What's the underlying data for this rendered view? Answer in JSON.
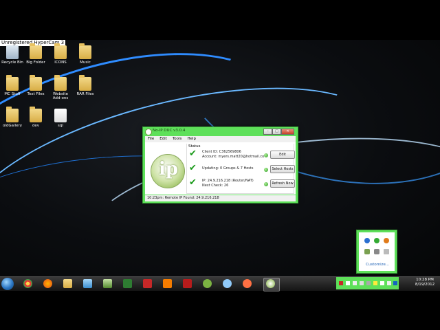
{
  "overlay": {
    "watermark": "Unregistered HyperCam 3"
  },
  "desktop_icons": [
    {
      "label": "Recycle Bin",
      "kind": "recycle"
    },
    {
      "label": "Big Folder",
      "kind": "folder"
    },
    {
      "label": "ICONS",
      "kind": "folder"
    },
    {
      "label": "Music",
      "kind": "folder"
    },
    {
      "label": "MC Stuff",
      "kind": "folder"
    },
    {
      "label": "Text Files",
      "kind": "folder"
    },
    {
      "label": "Website Add-ons",
      "kind": "folder"
    },
    {
      "label": "RAR Files",
      "kind": "folder"
    },
    {
      "label": "oldGallery",
      "kind": "folder"
    },
    {
      "label": "dev",
      "kind": "folder"
    },
    {
      "label": "sql",
      "kind": "doc"
    }
  ],
  "dialog": {
    "title": "No-IP DUC v3.0.4",
    "menu": [
      "File",
      "Edit",
      "Tools",
      "Help"
    ],
    "logo_text": "ip",
    "group_label": "Status",
    "rows": [
      {
        "line1": "Client ID: C362569806",
        "line2": "Account: myers.matt20@hotmail.co",
        "button": "Edit"
      },
      {
        "line1": "Updating: 0 Groups & 7 Hosts",
        "line2": "",
        "button": "Select Hosts"
      },
      {
        "line1": "IP: 24.9.216.218 (Router/NAT)",
        "line2": "Next Check: 26",
        "button": "Refresh Now"
      }
    ],
    "statusbar": "10:23pm: Remote IP Found: 24.9.216.218"
  },
  "tray_popup": {
    "customize_label": "Customize..."
  },
  "clock": {
    "time": "10:28 PM",
    "date": "8/19/2012"
  },
  "colors": {
    "accent_green": "#5ee05a",
    "check_green": "#1a9a1a"
  }
}
